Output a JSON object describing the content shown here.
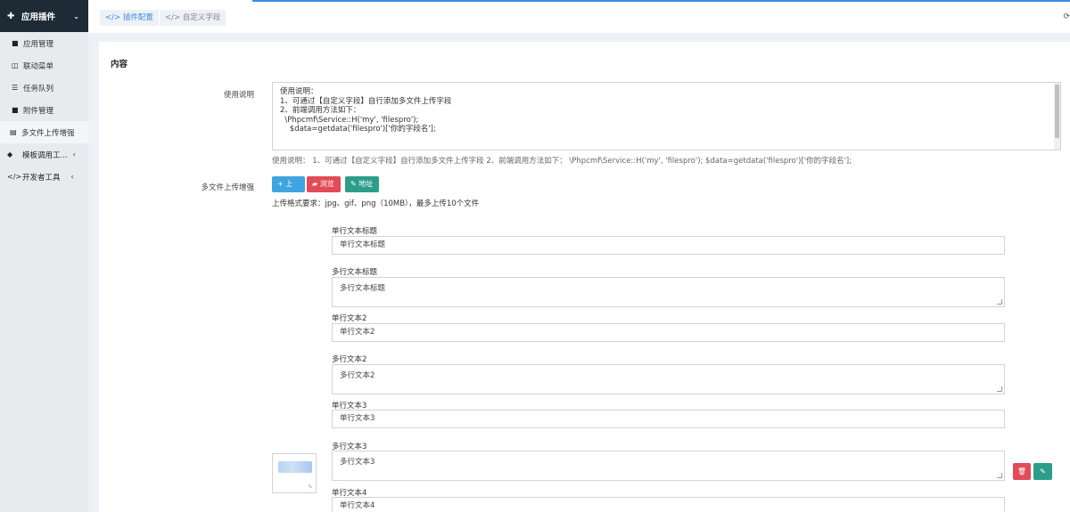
{
  "sidebar": {
    "header": {
      "icon": "puzzle-icon",
      "label": "应用插件"
    },
    "items": [
      {
        "label": "应用管理",
        "icon": "folder-icon"
      },
      {
        "label": "联动菜单",
        "icon": "columns-icon"
      },
      {
        "label": "任务队列",
        "icon": "list-icon"
      },
      {
        "label": "附件管理",
        "icon": "folder-icon"
      },
      {
        "label": "多文件上传增强",
        "icon": "file-icon"
      }
    ],
    "groups": [
      {
        "label": "模板调用工...",
        "icon": "tag-icon"
      },
      {
        "label": "开发者工具",
        "icon": "code-icon"
      }
    ]
  },
  "tabs": [
    {
      "label": "插件配置"
    },
    {
      "label": "自定义字段"
    }
  ],
  "panel": {
    "title": "内容",
    "usage_label": "使用说明",
    "usage_lines": [
      "使用说明：",
      "1、可通过【自定义字段】自行添加多文件上传字段",
      "2、前端调用方法如下：",
      "  \\Phpcmf\\Service::H('my', 'filespro');",
      "    $data=getdata('filespro')['你的字段名'];"
    ],
    "usage_help": "使用说明： 1、可通过【自定义字段】自行添加多文件上传字段 2、前端调用方法如下： \\Phpcmf\\Service::H('my', 'filespro'); $data=getdata('filespro')['你的字段名'];",
    "upload_label": "多文件上传增强",
    "buttons": {
      "upload": "上传",
      "browse": "浏览",
      "address": "地址"
    },
    "upload_requirement": "上传格式要求：jpg、gif、png（10MB），最多上传10个文件",
    "fields": [
      {
        "label": "单行文本标题",
        "value": "单行文本标题",
        "type": "single"
      },
      {
        "label": "多行文本标题",
        "value": "多行文本标题",
        "type": "multi"
      },
      {
        "label": "单行文本2",
        "value": "单行文本2",
        "type": "single"
      },
      {
        "label": "多行文本2",
        "value": "多行文本2",
        "type": "multi"
      },
      {
        "label": "单行文本3",
        "value": "单行文本3",
        "type": "single"
      },
      {
        "label": "多行文本3",
        "value": "多行文本3",
        "type": "multi"
      },
      {
        "label": "单行文本4",
        "value": "单行文本4",
        "type": "single"
      }
    ]
  },
  "colors": {
    "accent": "#3b8fe0",
    "sidebar_header": "#1f2a37",
    "danger": "#e24b57",
    "success": "#2b9e8a",
    "info": "#3ea5e0"
  }
}
